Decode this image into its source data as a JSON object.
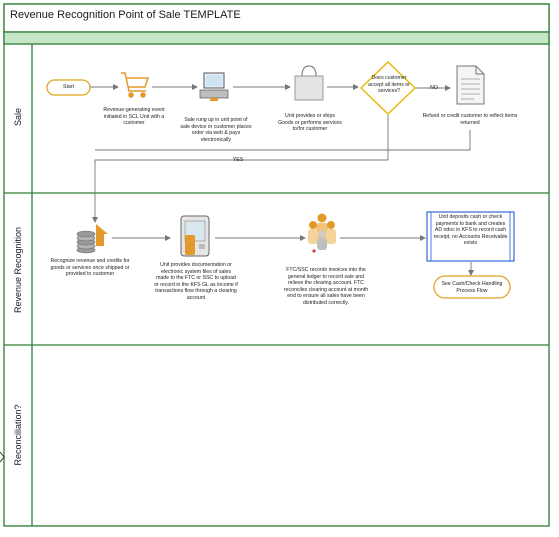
{
  "title": "Revenue Recognition Point of Sale TEMPLATE",
  "lanes": [
    {
      "label": "Sale"
    },
    {
      "label": "Revenue Recognition"
    },
    {
      "label": "Reconciliation?"
    }
  ],
  "nodes": {
    "start": "Start",
    "cart_caption": "Revenue-generating event initiated in SCL Unit with a customer",
    "register_caption": "Sale rung up in unit point of sale device or customer places order via web & pays electronically",
    "bag_caption": "Unit provides or ships Goods or performs services to/for customer",
    "decision": "Does customer accept all items or services?",
    "refund_caption": "Refund or credit customer to reflect items returned",
    "coins_caption": "Recognize revenue and credits for goods or services once shipped or provided to customer",
    "device_caption": "Unit provides documentation or electronic system files of sales made to the FTC or SSC to upload or record in the KFS GL as income if transactions flow through a clearing account",
    "people_caption": "FTC/SSC records invoices into the general ledger to record sale and relieve the clearing account. FTC reconciles clearing account at month end to ensure all sales have been distributed correctly.",
    "deposit_box": "Unit deposits cash or check payments to bank and creates AD ndoc in KFS to record cash receipt, no Accounts Receivable exists",
    "see_cash": "See Cash/Check Handling Process Flow"
  },
  "edges": {
    "no_label": "NO",
    "yes_label": "YES"
  },
  "colors": {
    "lane_border": "#2e7d32",
    "header_fill": "#c6e6c8",
    "arrow": "#777777",
    "start_border": "#e0a21b",
    "decision_border": "#e6b800",
    "deposit_border": "#1f5bd6",
    "icon_orange": "#e39a2a"
  }
}
